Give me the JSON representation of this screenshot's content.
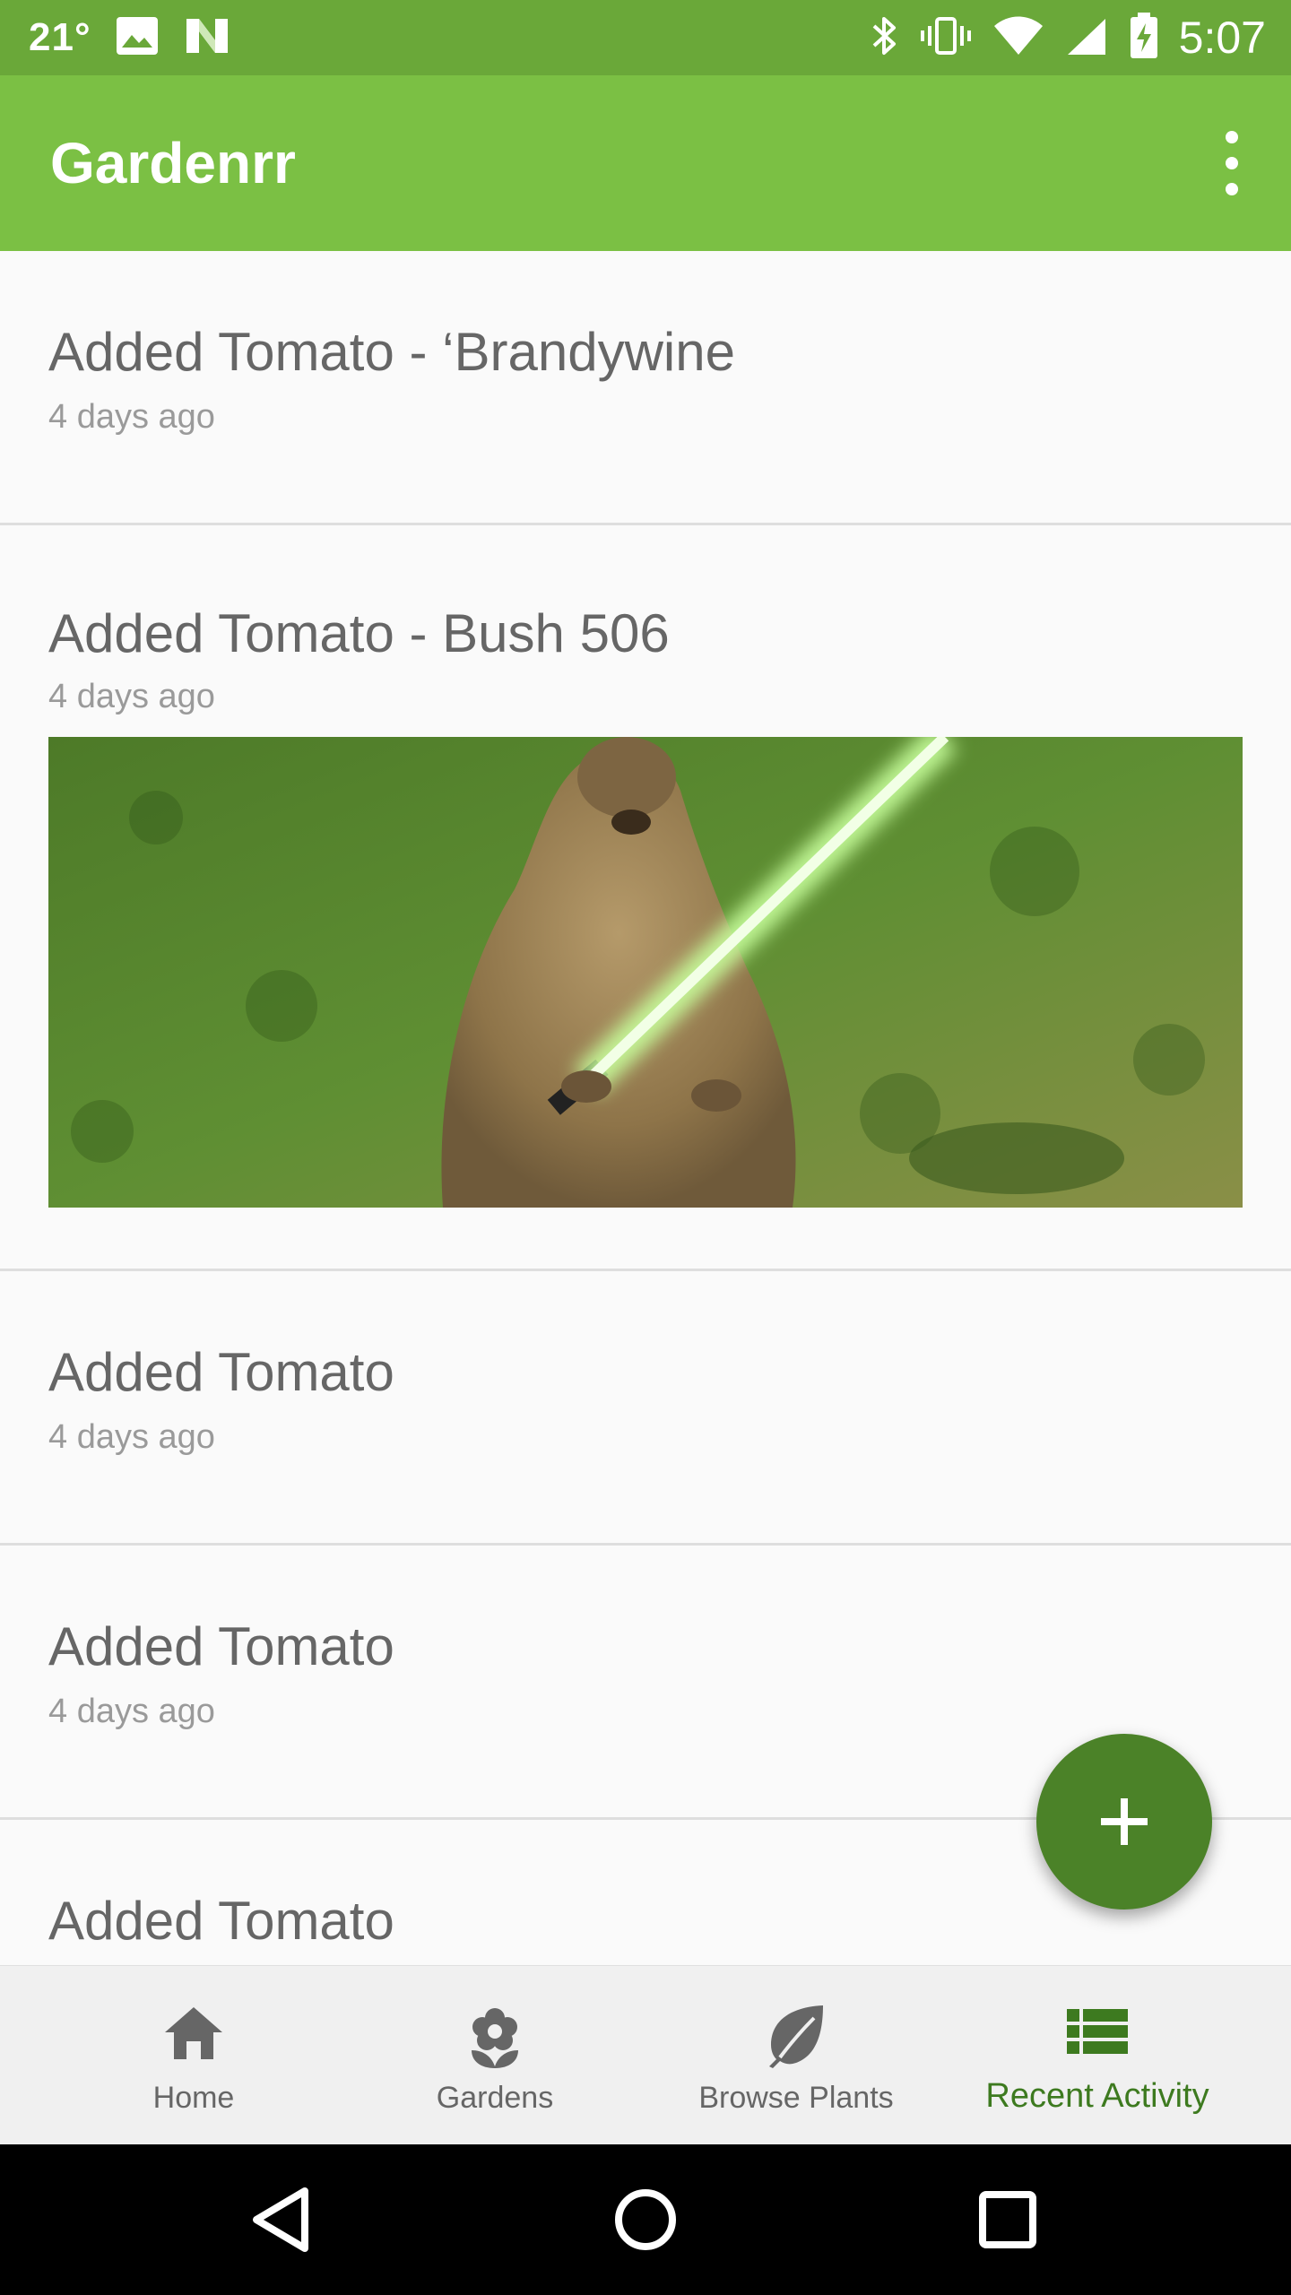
{
  "status_bar": {
    "temperature": "21°",
    "time": "5:07",
    "icons": [
      "image-icon",
      "n-app-icon",
      "bluetooth-icon",
      "vibrate-icon",
      "wifi-icon",
      "signal-icon",
      "battery-charging-icon"
    ]
  },
  "app_bar": {
    "title": "Gardenrr",
    "menu_icon": "more-vert-icon"
  },
  "feed": {
    "items": [
      {
        "title": "Added Tomato - ‘Brandywine",
        "time": "4 days ago"
      },
      {
        "title": "Added Tomato - Bush 506",
        "time": "4 days ago",
        "photo": "groundhog-with-lightsaber-photo"
      },
      {
        "title": "Added Tomato",
        "time": "4 days ago"
      },
      {
        "title": "Added Tomato",
        "time": "4 days ago"
      },
      {
        "title": "Added Tomato",
        "time": ""
      }
    ]
  },
  "fab": {
    "icon": "plus-icon"
  },
  "bottom_nav": {
    "items": [
      {
        "label": "Home",
        "icon": "home-icon"
      },
      {
        "label": "Gardens",
        "icon": "flower-icon"
      },
      {
        "label": "Browse Plants",
        "icon": "leaf-icon"
      },
      {
        "label": "Recent Activity",
        "icon": "list-icon",
        "active": true
      }
    ]
  },
  "colors": {
    "status_bar": "#6aa839",
    "app_bar": "#7bc044",
    "fab": "#4b8228",
    "active_nav": "#3d7a1f"
  },
  "system_nav": {
    "icons": [
      "back-icon",
      "home-circle-icon",
      "recents-icon"
    ]
  }
}
